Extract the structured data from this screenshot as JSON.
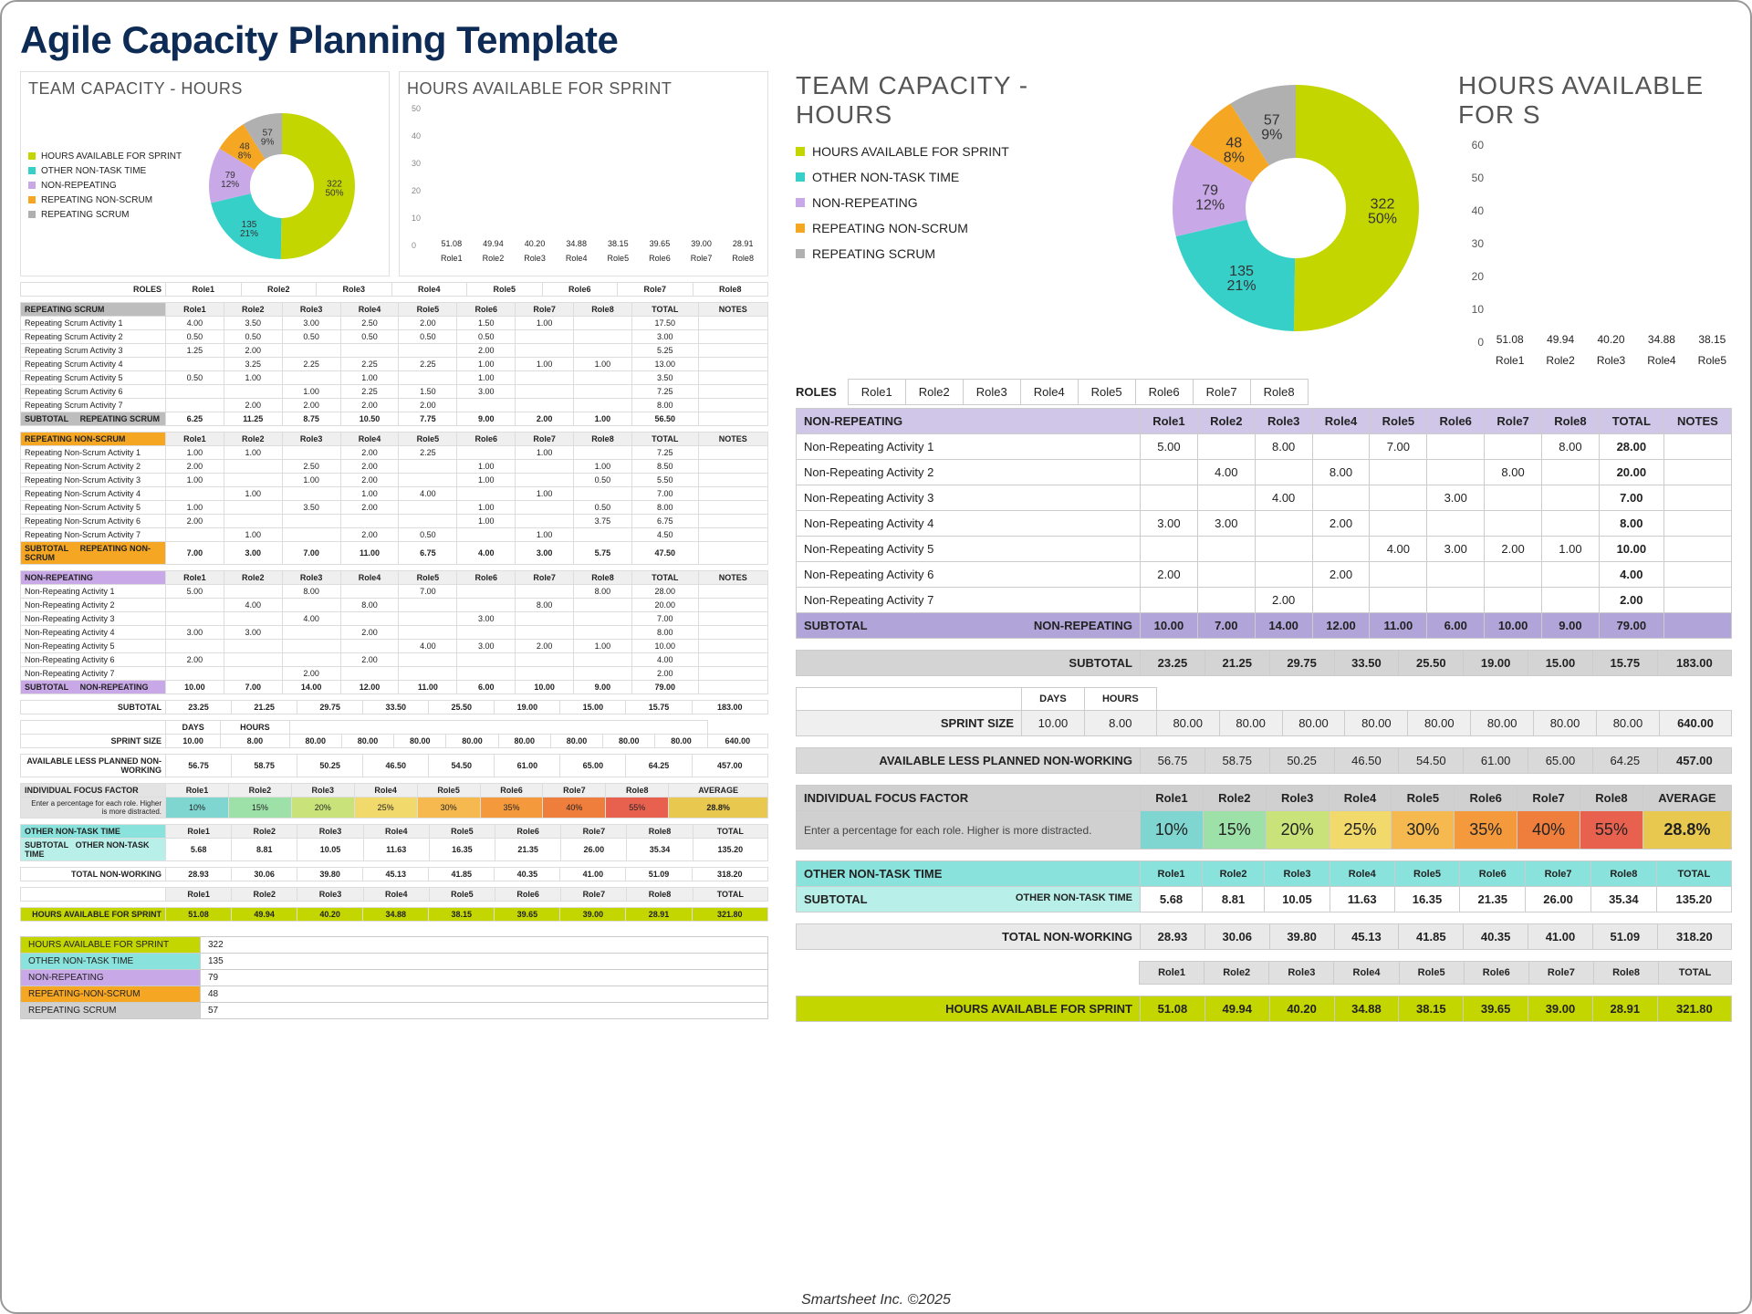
{
  "title": "Agile Capacity Planning Template",
  "footer": "Smartsheet Inc. ©2025",
  "roles": [
    "Role1",
    "Role2",
    "Role3",
    "Role4",
    "Role5",
    "Role6",
    "Role7",
    "Role8"
  ],
  "roles_label": "ROLES",
  "donut_title": "TEAM CAPACITY - HOURS",
  "bar_title": "HOURS AVAILABLE FOR SPRINT",
  "bar_title_clip": "HOURS AVAILABLE FOR S",
  "legend": [
    {
      "label": "HOURS AVAILABLE FOR SPRINT",
      "cls": "lg-green",
      "color": "#c4d600"
    },
    {
      "label": "OTHER NON-TASK TIME",
      "cls": "lg-cyan",
      "color": "#37d0c8"
    },
    {
      "label": "NON-REPEATING",
      "cls": "lg-purple",
      "color": "#c9a8e8"
    },
    {
      "label": "REPEATING NON-SCRUM",
      "cls": "lg-orange",
      "color": "#f5a623"
    },
    {
      "label": "REPEATING SCRUM",
      "cls": "lg-grey",
      "color": "#b0b0b0"
    }
  ],
  "chart_data": [
    {
      "type": "pie",
      "title": "TEAM CAPACITY - HOURS",
      "series": [
        {
          "name": "HOURS AVAILABLE FOR SPRINT",
          "value": 322,
          "pct": "50%",
          "color": "#c4d600"
        },
        {
          "name": "OTHER NON-TASK TIME",
          "value": 135,
          "pct": "21%",
          "color": "#37d0c8"
        },
        {
          "name": "NON-REPEATING",
          "value": 79,
          "pct": "12%",
          "color": "#c9a8e8"
        },
        {
          "name": "REPEATING NON-SCRUM",
          "value": 48,
          "pct": "8%",
          "color": "#f5a623"
        },
        {
          "name": "REPEATING SCRUM",
          "value": 57,
          "pct": "9%",
          "color": "#b0b0b0"
        }
      ]
    },
    {
      "type": "bar",
      "title": "HOURS AVAILABLE FOR SPRINT",
      "ylim": [
        0,
        60
      ],
      "categories": [
        "Role1",
        "Role2",
        "Role3",
        "Role4",
        "Role5",
        "Role6",
        "Role7",
        "Role8"
      ],
      "values": [
        51.08,
        49.94,
        40.2,
        34.88,
        38.15,
        39.65,
        39.0,
        28.91
      ],
      "labels": [
        "51.08",
        "49.94",
        "40.20",
        "34.88",
        "38.15",
        "39.65",
        "39.00",
        "28.91"
      ]
    }
  ],
  "repeating_scrum": {
    "title": "REPEATING SCRUM",
    "rows": [
      {
        "n": "Repeating Scrum Activity 1",
        "v": [
          "4.00",
          "3.50",
          "3.00",
          "2.50",
          "2.00",
          "1.50",
          "1.00",
          ""
        ],
        "t": "17.50"
      },
      {
        "n": "Repeating Scrum Activity 2",
        "v": [
          "0.50",
          "0.50",
          "0.50",
          "0.50",
          "0.50",
          "0.50",
          "",
          ""
        ],
        "t": "3.00"
      },
      {
        "n": "Repeating Scrum Activity 3",
        "v": [
          "1.25",
          "2.00",
          "",
          "",
          "",
          "2.00",
          "",
          ""
        ],
        "t": "5.25"
      },
      {
        "n": "Repeating Scrum Activity 4",
        "v": [
          "",
          "3.25",
          "2.25",
          "2.25",
          "2.25",
          "1.00",
          "1.00",
          "1.00"
        ],
        "t": "13.00"
      },
      {
        "n": "Repeating Scrum Activity 5",
        "v": [
          "0.50",
          "1.00",
          "",
          "1.00",
          "",
          "1.00",
          "",
          ""
        ],
        "t": "3.50"
      },
      {
        "n": "Repeating Scrum Activity 6",
        "v": [
          "",
          "",
          "1.00",
          "2.25",
          "1.50",
          "3.00",
          "",
          ""
        ],
        "t": "7.25"
      },
      {
        "n": "Repeating Scrum Activity 7",
        "v": [
          "",
          "2.00",
          "2.00",
          "2.00",
          "2.00",
          "",
          "",
          ""
        ],
        "t": "8.00"
      }
    ],
    "sub": [
      "6.25",
      "11.25",
      "8.75",
      "10.50",
      "7.75",
      "9.00",
      "2.00",
      "1.00"
    ],
    "total": "56.50"
  },
  "repeating_nonscrum": {
    "title": "REPEATING NON-SCRUM",
    "rows": [
      {
        "n": "Repeating Non-Scrum Activity 1",
        "v": [
          "1.00",
          "1.00",
          "",
          "2.00",
          "2.25",
          "",
          "1.00",
          ""
        ],
        "t": "7.25"
      },
      {
        "n": "Repeating Non-Scrum Activity 2",
        "v": [
          "2.00",
          "",
          "2.50",
          "2.00",
          "",
          "1.00",
          "",
          "1.00"
        ],
        "t": "8.50"
      },
      {
        "n": "Repeating Non-Scrum Activity 3",
        "v": [
          "1.00",
          "",
          "1.00",
          "2.00",
          "",
          "1.00",
          "",
          "0.50"
        ],
        "t": "5.50"
      },
      {
        "n": "Repeating Non-Scrum Activity 4",
        "v": [
          "",
          "1.00",
          "",
          "1.00",
          "4.00",
          "",
          "1.00",
          ""
        ],
        "t": "7.00"
      },
      {
        "n": "Repeating Non-Scrum Activity 5",
        "v": [
          "1.00",
          "",
          "3.50",
          "2.00",
          "",
          "1.00",
          "",
          "0.50"
        ],
        "t": "8.00"
      },
      {
        "n": "Repeating Non-Scrum Activity 6",
        "v": [
          "2.00",
          "",
          "",
          "",
          "",
          "1.00",
          "",
          "3.75"
        ],
        "t": "6.75"
      },
      {
        "n": "Repeating Non-Scrum Activity 7",
        "v": [
          "",
          "1.00",
          "",
          "2.00",
          "0.50",
          "",
          "1.00",
          ""
        ],
        "t": "4.50"
      }
    ],
    "sub": [
      "7.00",
      "3.00",
      "7.00",
      "11.00",
      "6.75",
      "4.00",
      "3.00",
      "5.75"
    ],
    "total": "47.50"
  },
  "non_repeating": {
    "title": "NON-REPEATING",
    "rows": [
      {
        "n": "Non-Repeating Activity 1",
        "v": [
          "5.00",
          "",
          "8.00",
          "",
          "7.00",
          "",
          "",
          "8.00"
        ],
        "t": "28.00"
      },
      {
        "n": "Non-Repeating Activity 2",
        "v": [
          "",
          "4.00",
          "",
          "8.00",
          "",
          "",
          "8.00",
          ""
        ],
        "t": "20.00"
      },
      {
        "n": "Non-Repeating Activity 3",
        "v": [
          "",
          "",
          "4.00",
          "",
          "",
          "3.00",
          "",
          ""
        ],
        "t": "7.00"
      },
      {
        "n": "Non-Repeating Activity 4",
        "v": [
          "3.00",
          "3.00",
          "",
          "2.00",
          "",
          "",
          "",
          ""
        ],
        "t": "8.00"
      },
      {
        "n": "Non-Repeating Activity 5",
        "v": [
          "",
          "",
          "",
          "",
          "4.00",
          "3.00",
          "2.00",
          "1.00"
        ],
        "t": "10.00"
      },
      {
        "n": "Non-Repeating Activity 6",
        "v": [
          "2.00",
          "",
          "",
          "2.00",
          "",
          "",
          "",
          ""
        ],
        "t": "4.00"
      },
      {
        "n": "Non-Repeating Activity 7",
        "v": [
          "",
          "",
          "2.00",
          "",
          "",
          "",
          "",
          ""
        ],
        "t": "2.00"
      }
    ],
    "sub": [
      "10.00",
      "7.00",
      "14.00",
      "12.00",
      "11.00",
      "6.00",
      "10.00",
      "9.00"
    ],
    "total": "79.00",
    "subtotal_label": "SUBTOTAL"
  },
  "subtotal_all": {
    "label": "SUBTOTAL",
    "v": [
      "23.25",
      "21.25",
      "29.75",
      "33.50",
      "25.50",
      "19.00",
      "15.00",
      "15.75"
    ],
    "t": "183.00"
  },
  "sprint": {
    "label": "SPRINT SIZE",
    "days_label": "DAYS",
    "hours_label": "HOURS",
    "days": "10.00",
    "hours": "8.00",
    "v": [
      "80.00",
      "80.00",
      "80.00",
      "80.00",
      "80.00",
      "80.00",
      "80.00",
      "80.00"
    ],
    "t": "640.00"
  },
  "avail_less": {
    "label": "AVAILABLE LESS PLANNED NON-WORKING",
    "v": [
      "56.75",
      "58.75",
      "50.25",
      "46.50",
      "54.50",
      "61.00",
      "65.00",
      "64.25"
    ],
    "t": "457.00"
  },
  "focus": {
    "title": "INDIVIDUAL FOCUS FACTOR",
    "note": "Enter a percentage for each role. Higher is more distracted.",
    "v": [
      "10%",
      "15%",
      "20%",
      "25%",
      "30%",
      "35%",
      "40%",
      "55%"
    ],
    "avg_label": "AVERAGE",
    "avg": "28.8%",
    "colors": [
      "#7fd6d0",
      "#9de0a8",
      "#c9e37a",
      "#f2d96b",
      "#f5b94f",
      "#f59a3c",
      "#ef7d3c",
      "#e8614f",
      "#e8c84f"
    ]
  },
  "other": {
    "title": "OTHER NON-TASK TIME",
    "sub_label": "SUBTOTAL",
    "sub_sublabel": "OTHER NON-TASK TIME",
    "v": [
      "5.68",
      "8.81",
      "10.05",
      "11.63",
      "16.35",
      "21.35",
      "26.00",
      "35.34"
    ],
    "t": "135.20"
  },
  "total_nonwork": {
    "label": "TOTAL NON-WORKING",
    "v": [
      "28.93",
      "30.06",
      "39.80",
      "45.13",
      "41.85",
      "40.35",
      "41.00",
      "51.09"
    ],
    "t": "318.20"
  },
  "hours_avail": {
    "label": "HOURS AVAILABLE FOR SPRINT",
    "v": [
      "51.08",
      "49.94",
      "40.20",
      "34.88",
      "38.15",
      "39.65",
      "39.00",
      "28.91"
    ],
    "t": "321.80"
  },
  "summary_table": [
    {
      "n": "HOURS AVAILABLE FOR SPRINT",
      "v": "322",
      "bg": "#c4d600"
    },
    {
      "n": "OTHER NON-TASK TIME",
      "v": "135",
      "bg": "#89e3dc"
    },
    {
      "n": "NON-REPEATING",
      "v": "79",
      "bg": "#c9a8e8"
    },
    {
      "n": "REPEATING-NON-SCRUM",
      "v": "48",
      "bg": "#f5a623"
    },
    {
      "n": "REPEATING SCRUM",
      "v": "57",
      "bg": "#d0d0d0"
    }
  ],
  "labels": {
    "total": "TOTAL",
    "notes": "NOTES",
    "subtotal": "SUBTOTAL"
  }
}
